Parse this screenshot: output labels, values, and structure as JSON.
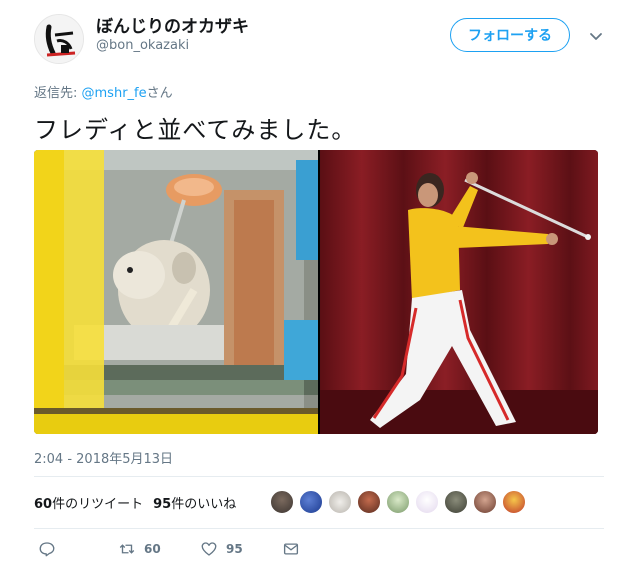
{
  "user": {
    "display_name": "ぼんじりのオカザキ",
    "handle": "@bon_okazaki",
    "avatar_icon": "avatar-logo-icon"
  },
  "follow_button": {
    "label": "フォローする"
  },
  "reply": {
    "prefix": "返信先: ",
    "mention": "@mshr_fe",
    "suffix": "さん"
  },
  "tweet": {
    "text": "フレディと並べてみました。",
    "timestamp": "2:04 - 2018年5月13日"
  },
  "stats": {
    "retweets_count": "60",
    "retweets_label": "件のリツイート",
    "likes_count": "95",
    "likes_label": "件のいいね"
  },
  "actions": {
    "reply_icon": "reply-icon",
    "retweet_icon": "retweet-icon",
    "retweet_count": "60",
    "like_icon": "heart-icon",
    "like_count": "95",
    "dm_icon": "envelope-icon"
  },
  "colors": {
    "accent": "#1da1f2",
    "muted": "#657786",
    "text": "#14171a"
  }
}
